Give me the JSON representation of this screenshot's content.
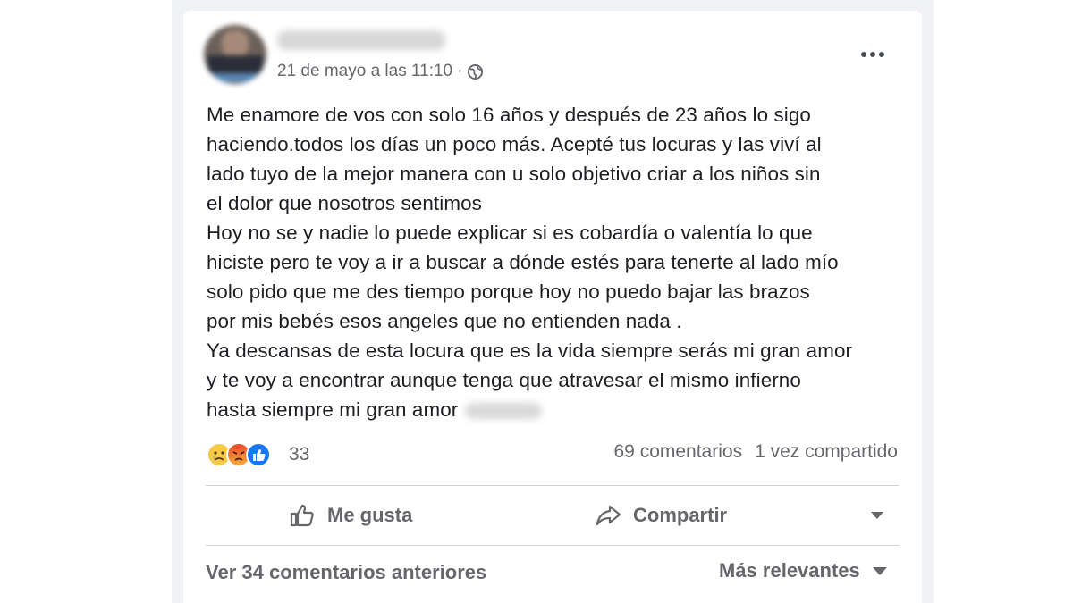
{
  "post": {
    "timestamp": "21 de mayo a las 11:10",
    "meta_separator": "·",
    "privacy_icon": "globe-icon",
    "menu_icon": "more-options-icon",
    "text_lines": [
      "Me enamore de vos con solo 16 años y después de 23 años lo sigo",
      "haciendo.todos los días un poco más. Acepté tus locuras y las viví al",
      "lado tuyo de la mejor manera con u solo objetivo criar a los niños sin",
      "el dolor que nosotros sentimos",
      "Hoy no se y nadie lo puede explicar si es cobardía o valentía lo que",
      "hiciste pero te voy a ir a buscar a dónde estés para tenerte al lado mío",
      "solo pido que me des tiempo porque hoy no puedo bajar las brazos",
      "por mis bebés esos angeles que no entienden nada .",
      "Ya descansas de esta locura que es la vida siempre serás mi gran amor",
      "y te voy a encontrar aunque tenga que atravesar el mismo infierno",
      "hasta siempre mi gran amor"
    ]
  },
  "reactions": {
    "icons": [
      "sad-reaction-icon",
      "angry-reaction-icon",
      "like-reaction-icon"
    ],
    "count": "33"
  },
  "stats": {
    "comments": "69 comentarios",
    "shares": "1 vez compartido"
  },
  "actions": {
    "like_label": "Me gusta",
    "share_label": "Compartir"
  },
  "comments": {
    "view_previous": "Ver 34 comentarios anteriores",
    "sort_label": "Más relevantes"
  },
  "colors": {
    "text": "#1c1e21",
    "secondary_text": "#65676b",
    "feed_background": "#f0f2f5",
    "like_blue": "#1877f2",
    "divider": "#ced0d4"
  }
}
